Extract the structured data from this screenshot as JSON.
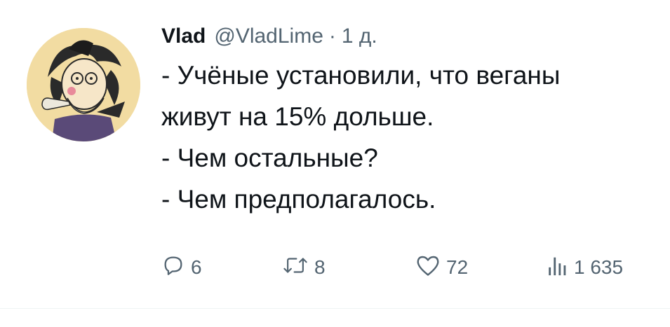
{
  "tweet": {
    "author_name": "Vlad",
    "handle": "@VladLime",
    "separator": "·",
    "time": "1 д.",
    "lines": [
      "- Учёные установили, что веганы",
      "живут на 15% дольше.",
      "- Чем остальные?",
      "- Чем предполагалось."
    ]
  },
  "actions": {
    "reply": {
      "icon": "reply-bubble-icon",
      "count": "6"
    },
    "retweet": {
      "icon": "retweet-icon",
      "count": "8"
    },
    "like": {
      "icon": "heart-icon",
      "count": "72"
    },
    "views": {
      "icon": "views-chart-icon",
      "count": "1 635"
    }
  },
  "colors": {
    "text_primary": "#0f1419",
    "text_secondary": "#536471",
    "background": "#ffffff"
  }
}
